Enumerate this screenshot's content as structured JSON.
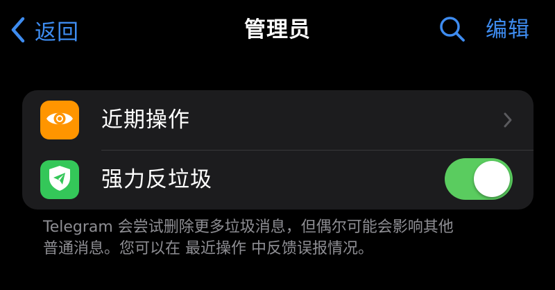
{
  "header": {
    "back_label": "返回",
    "title": "管理员",
    "edit_label": "编辑"
  },
  "icons": {
    "back": "chevron-left-icon",
    "search": "search-icon",
    "recent_actions": "eye-icon",
    "anti_spam": "shield-send-icon",
    "row_chevron": "chevron-right-icon"
  },
  "rows": [
    {
      "label": "近期操作",
      "icon_color": "#FF9500",
      "accessory": "chevron"
    },
    {
      "label": "强力反垃圾",
      "icon_color": "#34C759",
      "accessory": "toggle",
      "toggle_on": true
    }
  ],
  "footer": {
    "line1": "Telegram 会尝试删除更多垃圾消息，但偶尔可能会影响其他",
    "line2_prefix": "普通消息。您可以在 ",
    "line2_link": "最近操作",
    "line2_suffix": " 中反馈误报情况。"
  },
  "colors": {
    "accent": "#3E8CF0",
    "background": "#000000",
    "card": "#1C1C1E",
    "toggle_on": "#5ACC5F",
    "secondary_text": "#8E8E93"
  }
}
